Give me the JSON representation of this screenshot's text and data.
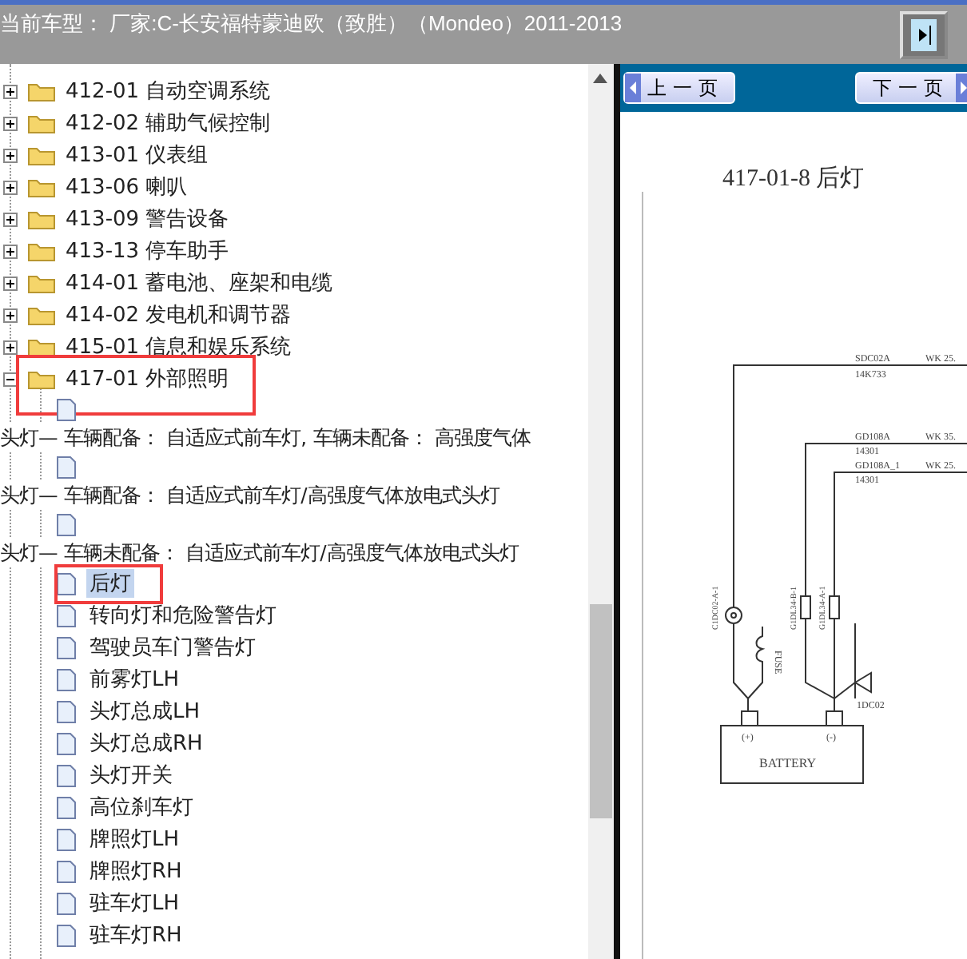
{
  "header": {
    "title": "当前车型： 厂家:C-长安福特蒙迪欧（致胜）（Mondeo）2011-2013"
  },
  "tree": [
    {
      "label": "412-01 自动空调系统",
      "expanded": false,
      "highlighted": false
    },
    {
      "label": "412-02 辅助气候控制",
      "expanded": false,
      "highlighted": false
    },
    {
      "label": "413-01 仪表组",
      "expanded": false,
      "highlighted": false
    },
    {
      "label": "413-06 喇叭",
      "expanded": false,
      "highlighted": false
    },
    {
      "label": "413-09 警告设备",
      "expanded": false,
      "highlighted": false
    },
    {
      "label": "413-13 停车助手",
      "expanded": false,
      "highlighted": false
    },
    {
      "label": "414-01 蓄电池、座架和电缆",
      "expanded": false,
      "highlighted": false
    },
    {
      "label": "414-02 发电机和调节器",
      "expanded": false,
      "highlighted": false
    },
    {
      "label": "415-01 信息和娱乐系统",
      "expanded": false,
      "highlighted": false
    },
    {
      "label": "417-01 外部照明",
      "expanded": true,
      "highlighted": true,
      "children": [
        {
          "kind": "captioned",
          "caption": "头灯— 车辆配备： 自适应式前车灯, 车辆未配备： 高强度气体",
          "selected": false,
          "highlighted": false
        },
        {
          "kind": "captioned",
          "caption": "头灯— 车辆配备： 自适应式前车灯/高强度气体放电式头灯",
          "selected": false,
          "highlighted": false
        },
        {
          "kind": "captioned",
          "caption": "头灯— 车辆未配备： 自适应式前车灯/高强度气体放电式头灯",
          "selected": false,
          "highlighted": false
        },
        {
          "kind": "leaf",
          "label": "后灯",
          "selected": true,
          "highlighted": true
        },
        {
          "kind": "leaf",
          "label": "转向灯和危险警告灯",
          "selected": false,
          "highlighted": false
        },
        {
          "kind": "leaf",
          "label": "驾驶员车门警告灯",
          "selected": false,
          "highlighted": false
        },
        {
          "kind": "leaf",
          "label": "前雾灯LH",
          "selected": false,
          "highlighted": false
        },
        {
          "kind": "leaf",
          "label": "头灯总成LH",
          "selected": false,
          "highlighted": false
        },
        {
          "kind": "leaf",
          "label": "头灯总成RH",
          "selected": false,
          "highlighted": false
        },
        {
          "kind": "leaf",
          "label": "头灯开关",
          "selected": false,
          "highlighted": false
        },
        {
          "kind": "leaf",
          "label": "高位刹车灯",
          "selected": false,
          "highlighted": false
        },
        {
          "kind": "leaf",
          "label": "牌照灯LH",
          "selected": false,
          "highlighted": false
        },
        {
          "kind": "leaf",
          "label": "牌照灯RH",
          "selected": false,
          "highlighted": false
        },
        {
          "kind": "leaf",
          "label": "驻车灯LH",
          "selected": false,
          "highlighted": false
        },
        {
          "kind": "leaf",
          "label": "驻车灯RH",
          "selected": false,
          "highlighted": false
        }
      ]
    }
  ],
  "nav": {
    "prev": "上一页",
    "next": "下一页"
  },
  "document": {
    "title": "417-01-8 后灯",
    "wire_labels": [
      "SDC02A",
      "WK 25.",
      "14K733",
      "GD108A",
      "WK 35.",
      "14301",
      "GD108A_1",
      "WK 25.",
      "14301"
    ],
    "connector_labels": [
      "C1DC02-A-1",
      "G1DL34-B-1",
      "G1DL34-A-1"
    ],
    "fuse_label": "FUSE",
    "ground_label": "1DC02",
    "plus_label": "(+)",
    "minus_label": "(-)",
    "battery_label": "BATTERY"
  }
}
